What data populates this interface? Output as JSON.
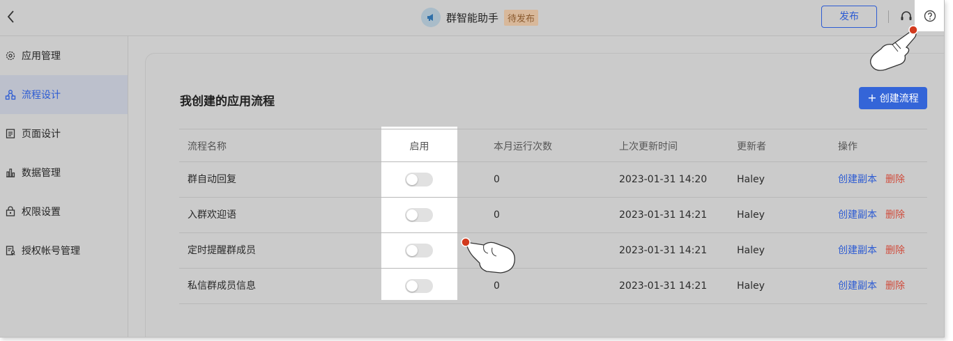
{
  "header": {
    "title": "群智能助手",
    "status": "待发布",
    "publish_label": "发布"
  },
  "sidebar": {
    "items": [
      {
        "label": "应用管理",
        "icon": "gear-icon"
      },
      {
        "label": "流程设计",
        "icon": "flow-icon",
        "active": true
      },
      {
        "label": "页面设计",
        "icon": "page-icon"
      },
      {
        "label": "数据管理",
        "icon": "bar-chart-icon"
      },
      {
        "label": "权限设置",
        "icon": "lock-icon"
      },
      {
        "label": "授权帐号管理",
        "icon": "account-icon"
      }
    ]
  },
  "main": {
    "section_title": "我创建的应用流程",
    "create_label": "创建流程",
    "table": {
      "headers": {
        "name": "流程名称",
        "enable": "启用",
        "runs": "本月运行次数",
        "time": "上次更新时间",
        "user": "更新者",
        "ops": "操作"
      },
      "rows": [
        {
          "name": "群自动回复",
          "enabled": false,
          "runs": "0",
          "time": "2023-01-31 14:20",
          "user": "Haley",
          "copy": "创建副本",
          "delete": "删除"
        },
        {
          "name": "入群欢迎语",
          "enabled": false,
          "runs": "0",
          "time": "2023-01-31 14:21",
          "user": "Haley",
          "copy": "创建副本",
          "delete": "删除"
        },
        {
          "name": "定时提醒群成员",
          "enabled": false,
          "runs": "",
          "time": "2023-01-31 14:21",
          "user": "Haley",
          "copy": "创建副本",
          "delete": "删除"
        },
        {
          "name": "私信群成员信息",
          "enabled": false,
          "runs": "0",
          "time": "2023-01-31 14:21",
          "user": "Haley",
          "copy": "创建副本",
          "delete": "删除"
        }
      ]
    }
  },
  "colors": {
    "accent": "#2c5bd3",
    "danger": "#d04b3b",
    "badge_bg": "#d8b89a"
  }
}
